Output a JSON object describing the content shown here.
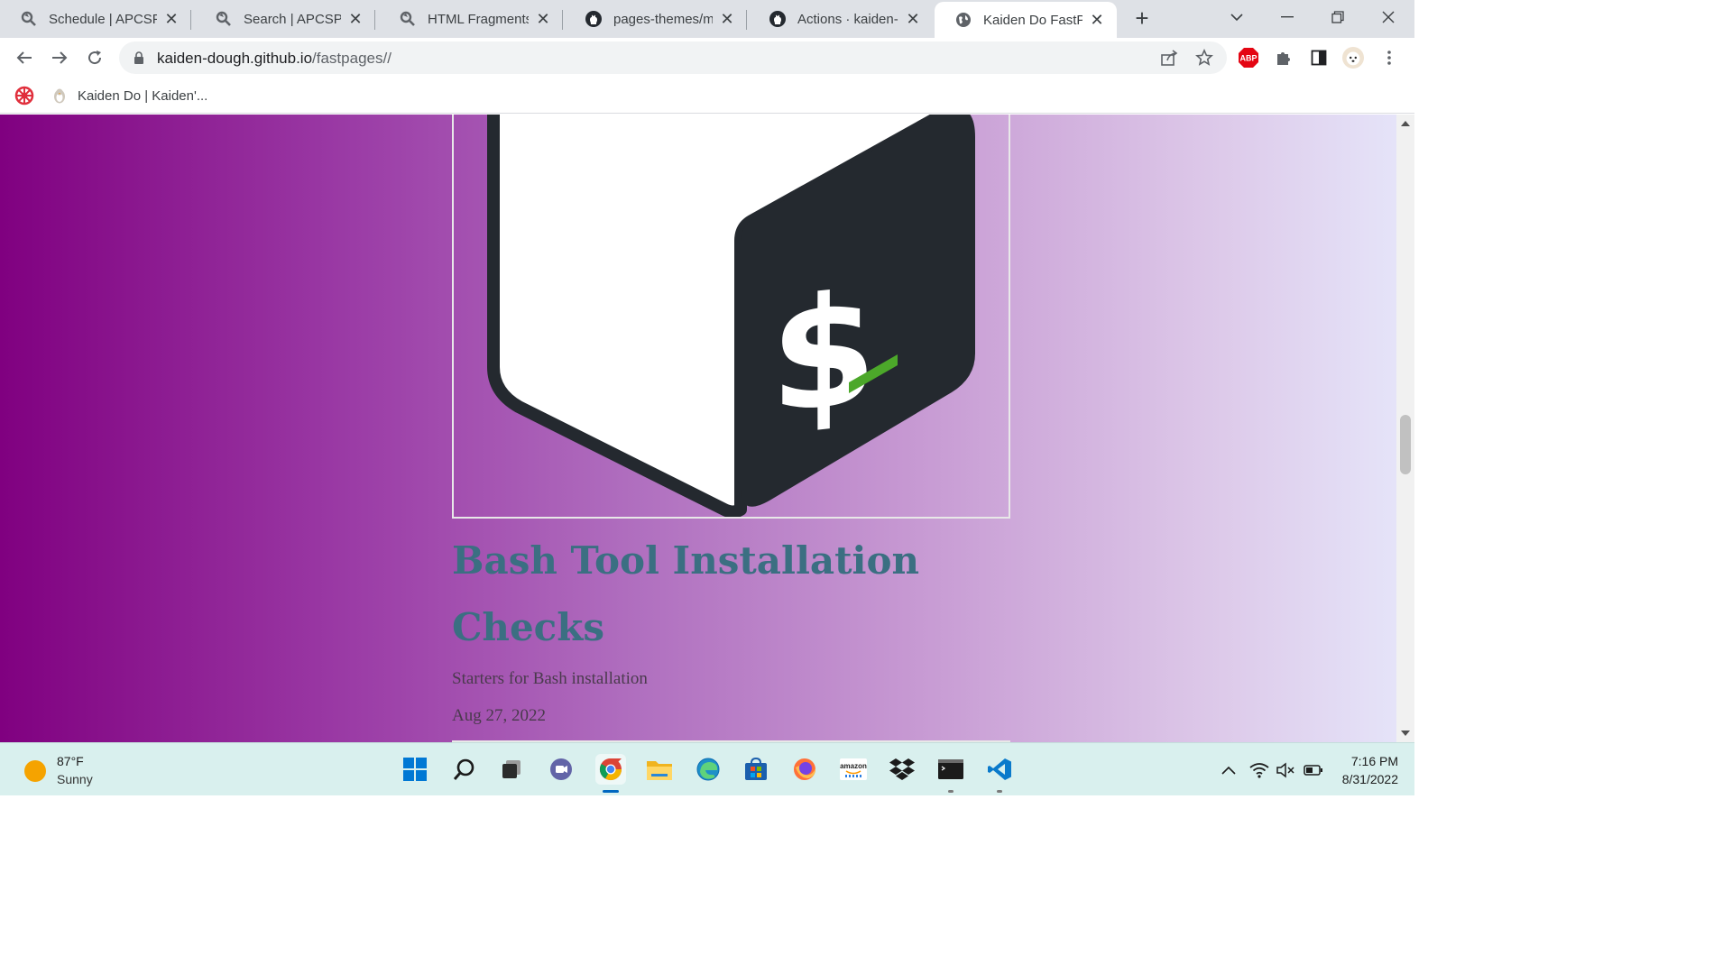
{
  "browser": {
    "tabs": [
      {
        "title": "Schedule | APCSP",
        "favicon": "apcsp-icon",
        "active": false
      },
      {
        "title": "Search | APCSP",
        "favicon": "apcsp-icon",
        "active": false
      },
      {
        "title": "HTML Fragments | A",
        "favicon": "apcsp-icon",
        "active": false
      },
      {
        "title": "pages-themes/merl",
        "favicon": "github-icon",
        "active": false
      },
      {
        "title": "Actions · kaiden-do",
        "favicon": "github-icon",
        "active": false
      },
      {
        "title": "Kaiden Do FastPage",
        "favicon": "globe-icon",
        "active": true
      }
    ],
    "url_host": "kaiden-dough.github.io",
    "url_path": "/fastpages//",
    "extensions": {
      "adblock_label": "ABP"
    },
    "bookmarks": [
      {
        "label": "",
        "icon": "settings-wheel-icon"
      },
      {
        "label": "Kaiden Do | Kaiden'...",
        "icon": "penguin-icon"
      }
    ]
  },
  "page": {
    "post": {
      "image": "bash-logo",
      "title": "Bash Tool Installation Checks",
      "description": "Starters for Bash installation",
      "date": "Aug 27, 2022"
    },
    "colors": {
      "gradient_start": "#800080",
      "gradient_end": "#e6e6fa",
      "title_color": "#3b6f82"
    }
  },
  "taskbar": {
    "weather": {
      "temp": "87°F",
      "condition": "Sunny"
    },
    "apps": [
      {
        "name": "windows-start-icon",
        "active": false
      },
      {
        "name": "search-icon",
        "active": false
      },
      {
        "name": "task-view-icon",
        "active": false
      },
      {
        "name": "teams-chat-icon",
        "active": false
      },
      {
        "name": "chrome-icon",
        "active": true
      },
      {
        "name": "file-explorer-icon",
        "active": false
      },
      {
        "name": "edge-icon",
        "active": false
      },
      {
        "name": "microsoft-store-icon",
        "active": false
      },
      {
        "name": "firefox-icon",
        "active": false
      },
      {
        "name": "amazon-icon",
        "active": false
      },
      {
        "name": "dropbox-icon",
        "active": false
      },
      {
        "name": "terminal-icon",
        "active": false
      },
      {
        "name": "vscode-icon",
        "active": false
      }
    ],
    "amazon_label": "amazon",
    "clock": {
      "time": "7:16 PM",
      "date": "8/31/2022"
    }
  }
}
